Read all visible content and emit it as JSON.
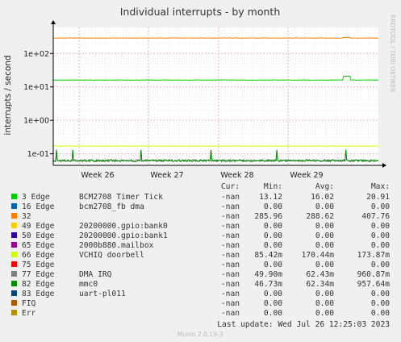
{
  "chart_data": {
    "type": "line",
    "title": "Individual interrupts - by month",
    "ylabel": "interrupts / second",
    "side_label": "RRDTOOL / TOBI OETIKER",
    "yscale": "log",
    "ylim": [
      0.045,
      600
    ],
    "yticks": [
      {
        "v": 100,
        "label": "1e+02"
      },
      {
        "v": 10,
        "label": "1e+01"
      },
      {
        "v": 1,
        "label": "1e+00"
      },
      {
        "v": 0.1,
        "label": "1e-01"
      }
    ],
    "xticks": [
      "Week 26",
      "Week 27",
      "Week 28",
      "Week 29"
    ],
    "columns": [
      "Cur:",
      "Min:",
      "Avg:",
      "Max:"
    ],
    "series": [
      {
        "name": "3 Edge",
        "desc": "BCM2708 Timer Tick",
        "color": "#00cc00",
        "cur": "-nan",
        "min": "13.12",
        "avg": "16.02",
        "max": "20.91",
        "base": 16.02,
        "spike": 20.91
      },
      {
        "name": "16 Edge",
        "desc": "bcm2708_fb dma",
        "color": "#0066b3",
        "cur": "-nan",
        "min": "0.00",
        "avg": "0.00",
        "max": "0.00"
      },
      {
        "name": "32",
        "desc": "",
        "color": "#ff8000",
        "cur": "-nan",
        "min": "285.96",
        "avg": "288.62",
        "max": "407.76",
        "base": 288.62,
        "spike": 300
      },
      {
        "name": "49 Edge",
        "desc": "20200000.gpio:bank0",
        "color": "#ffcc00",
        "cur": "-nan",
        "min": "0.00",
        "avg": "0.00",
        "max": "0.00"
      },
      {
        "name": "50 Edge",
        "desc": "20200000.gpio:bank1",
        "color": "#330099",
        "cur": "-nan",
        "min": "0.00",
        "avg": "0.00",
        "max": "0.00"
      },
      {
        "name": "65 Edge",
        "desc": "2000b880.mailbox",
        "color": "#990099",
        "cur": "-nan",
        "min": "0.00",
        "avg": "0.00",
        "max": "0.00"
      },
      {
        "name": "66 Edge",
        "desc": "VCHIQ doorbell",
        "color": "#ccff00",
        "cur": "-nan",
        "min": "85.42m",
        "avg": "170.44m",
        "max": "173.87m",
        "base": 0.17044
      },
      {
        "name": "75 Edge",
        "desc": "",
        "color": "#ff0000",
        "cur": "-nan",
        "min": "0.00",
        "avg": "0.00",
        "max": "0.00"
      },
      {
        "name": "77 Edge",
        "desc": "DMA IRQ",
        "color": "#808080",
        "cur": "-nan",
        "min": "49.90m",
        "avg": "62.43m",
        "max": "960.87m",
        "base": 0.0624,
        "spike": 0.13
      },
      {
        "name": "82 Edge",
        "desc": "mmc0",
        "color": "#008f00",
        "cur": "-nan",
        "min": "46.73m",
        "avg": "62.34m",
        "max": "957.64m",
        "base": 0.0623,
        "spike": 0.13
      },
      {
        "name": "83 Edge",
        "desc": "uart-pl011",
        "color": "#00487d",
        "cur": "-nan",
        "min": "0.00",
        "avg": "0.00",
        "max": "0.00"
      },
      {
        "name": "FIQ",
        "desc": "",
        "color": "#b35a00",
        "cur": "-nan",
        "min": "0.00",
        "avg": "0.00",
        "max": "0.00"
      },
      {
        "name": "Err",
        "desc": "",
        "color": "#b38f00",
        "cur": "-nan",
        "min": "0.00",
        "avg": "0.00",
        "max": "0.00"
      }
    ],
    "last_update": "Last update:  Wed Jul 26 12:25:03 2023",
    "footer": "Munin 2.0.19-3"
  }
}
